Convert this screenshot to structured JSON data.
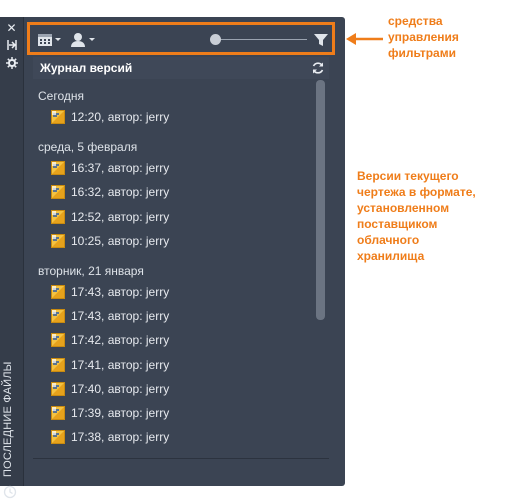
{
  "palette": {
    "side_title": "ПОСЛЕДНИЕ ФАЙЛЫ",
    "side_buttons": [
      "close-icon",
      "auto-hide-icon",
      "properties-icon"
    ]
  },
  "toolbar": {
    "icons": [
      "calendar-filter-icon",
      "user-filter-icon",
      "filter-icon"
    ],
    "slider_position": 0.0
  },
  "header": {
    "title": "Журнал версий"
  },
  "groups": [
    {
      "label": "Сегодня",
      "items": [
        "12:20, автор: jerry"
      ]
    },
    {
      "label": "среда, 5 февраля",
      "items": [
        "16:37, автор: jerry",
        "16:32, автор: jerry",
        "12:52, автор: jerry",
        "10:25, автор: jerry"
      ]
    },
    {
      "label": "вторник, 21 января",
      "items": [
        "17:43, автор: jerry",
        "17:43, автор: jerry",
        "17:42, автор: jerry",
        "17:41, автор: jerry",
        "17:40, автор: jerry",
        "17:39, автор: jerry",
        "17:38, автор: jerry"
      ]
    }
  ],
  "annotations": {
    "filter_controls": [
      "средства",
      "управления",
      "фильтрами"
    ],
    "versions_note": [
      "Версии текущего",
      "чертежа в формате,",
      "установленном",
      "поставщиком",
      "облачного",
      "хранилища"
    ]
  },
  "colors": {
    "accent": "#ef7d1a",
    "panel": "#3b4453"
  }
}
